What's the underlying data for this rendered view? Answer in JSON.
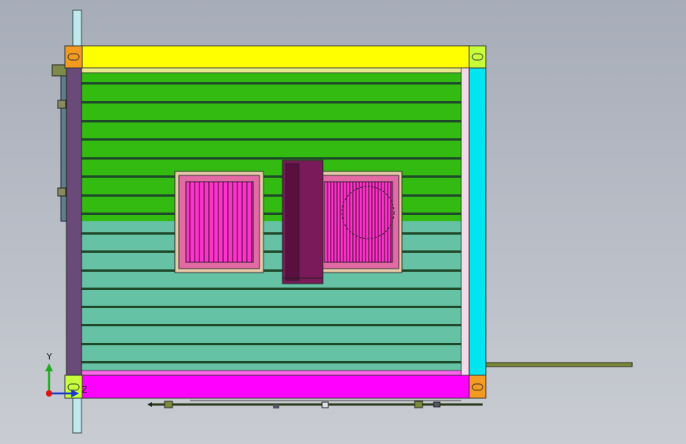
{
  "viewport": {
    "background_top": "#a7adb8",
    "background_bottom": "#c9ccd2"
  },
  "model": {
    "colors": {
      "top_bar": "#ffff00",
      "bottom_bar": "#ff00ff",
      "left_post": "#6a4a78",
      "right_post": "#00e5f0",
      "panel_green": "#33bb11",
      "panel_teal": "#66c2a5",
      "frame_magenta": "#e36aa5",
      "grille_magenta": "#ff33cc",
      "box_purple": "#7a1a5a",
      "corner_orange": "#f39a21",
      "corner_lime": "#c7ff3a"
    }
  },
  "triad": {
    "y_label": "Y",
    "z_label": "Z"
  }
}
